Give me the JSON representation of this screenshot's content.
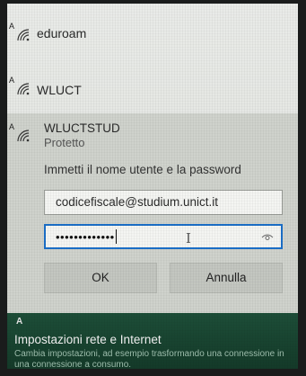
{
  "networks": [
    {
      "name": "eduroam"
    },
    {
      "name": "WLUCT"
    },
    {
      "name": "WLUCTSTUD",
      "status": "Protetto"
    }
  ],
  "secured_badge": "A",
  "connect_form": {
    "prompt": "Immetti il nome utente e la password",
    "username_value": "codicefiscale@studium.unict.it",
    "password_masked": "•••••••••••••",
    "ok_label": "OK",
    "cancel_label": "Annulla"
  },
  "network_settings": {
    "badge": "A",
    "title": "Impostazioni rete e Internet",
    "description": "Cambia impostazioni, ad esempio trasformando una connessione in una connessione a consumo."
  },
  "icons": {
    "network": "wifi-secured-icon",
    "reveal": "eye-icon",
    "cursor": "text-cursor-icon"
  },
  "colors": {
    "focus_border": "#1b6fc8",
    "settings_background": "#1d4e38"
  }
}
